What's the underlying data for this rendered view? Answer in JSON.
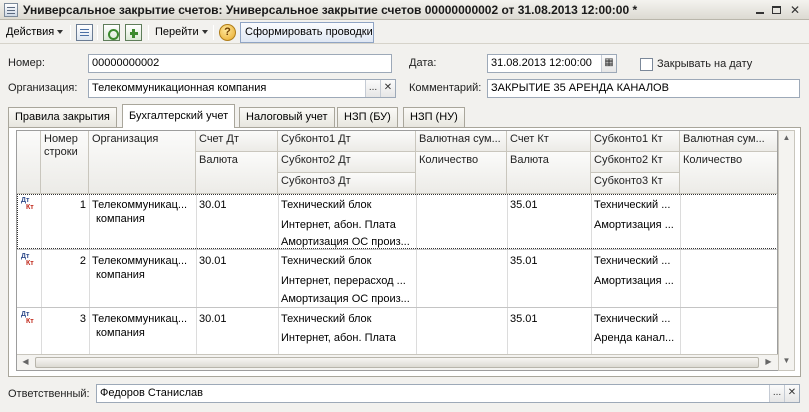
{
  "window": {
    "title": "Универсальное закрытие счетов: Универсальное закрытие счетов 00000000002 от 31.08.2013 12:00:00 *",
    "min_glyph": "",
    "close_glyph": "✕"
  },
  "toolbar": {
    "actions_label": "Действия",
    "goto_label": "Перейти",
    "help_glyph": "?",
    "generate_button": "Сформировать проводки"
  },
  "form": {
    "number_label": "Номер:",
    "number_value": "00000000002",
    "date_label": "Дата:",
    "date_value": "31.08.2013 12:00:00",
    "close_on_date_label": "Закрывать на дату",
    "org_label": "Организация:",
    "org_value": "Телекоммуникационная компания",
    "comment_label": "Комментарий:",
    "comment_value": "ЗАКРЫТИЕ 35 АРЕНДА КАНАЛОВ",
    "responsible_label": "Ответственный:",
    "responsible_value": "Федоров Станислав",
    "select_glyph": "...",
    "clear_glyph": "✕",
    "calendar_glyph": "▦"
  },
  "tabs": [
    {
      "label": "Правила закрытия"
    },
    {
      "label": "Бухгалтерский учет"
    },
    {
      "label": "Налоговый учет"
    },
    {
      "label": "НЗП (БУ)"
    },
    {
      "label": "НЗП (НУ)"
    }
  ],
  "table": {
    "headers": {
      "row_num_1": "Номер",
      "row_num_2": "строки",
      "org": "Организация",
      "dt_account": "Счет Дт",
      "dt_currency": "Валюта",
      "sub1_dt": "Субконто1 Дт",
      "sub2_dt": "Субконто2 Дт",
      "sub3_dt": "Субконто3 Дт",
      "cur_sum_dt": "Валютная сум...",
      "qty_dt": "Количество",
      "kt_account": "Счет Кт",
      "kt_currency": "Валюта",
      "sub1_kt": "Субконто1 Кт",
      "sub2_kt": "Субконто2 Кт",
      "sub3_kt": "Субконто3 Кт",
      "cur_sum_kt": "Валютная сум...",
      "qty_kt": "Количество"
    },
    "dtkt_label": {
      "dt": "Дт",
      "kt": "Кт"
    },
    "rows": [
      {
        "num": "1",
        "org_1": "Телекоммуникац...",
        "org_2": "компания",
        "dt": "30.01",
        "sub1_dt": "Технический блок",
        "sub2_dt": "Интернет, абон. Плата",
        "sub3_dt": "Амортизация ОС произ...",
        "kt": "35.01",
        "sub1_kt": "Технический ...",
        "sub2_kt": "Амортизация ..."
      },
      {
        "num": "2",
        "org_1": "Телекоммуникац...",
        "org_2": "компания",
        "dt": "30.01",
        "sub1_dt": "Технический блок",
        "sub2_dt": "Интернет, перерасход ...",
        "sub3_dt": "Амортизация ОС произ...",
        "kt": "35.01",
        "sub1_kt": "Технический ...",
        "sub2_kt": "Амортизация ..."
      },
      {
        "num": "3",
        "org_1": "Телекоммуникац...",
        "org_2": "компания",
        "dt": "30.01",
        "sub1_dt": "Технический блок",
        "sub2_dt": "Интернет, абон. Плата",
        "kt": "35.01",
        "sub1_kt": "Технический ...",
        "sub2_kt": "Аренда канал..."
      }
    ]
  }
}
